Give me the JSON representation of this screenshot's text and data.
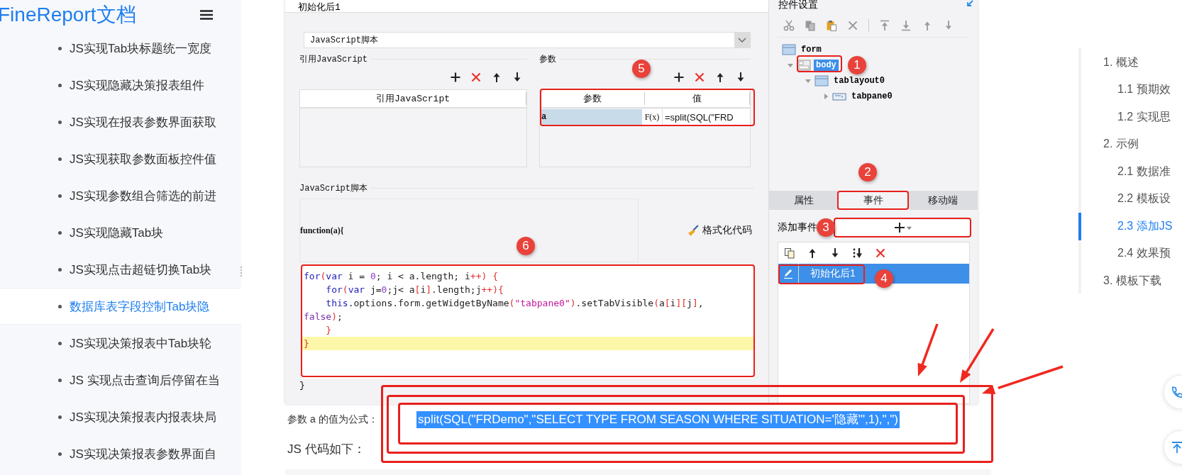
{
  "sidebar": {
    "logo": "FineReport文档",
    "items": [
      {
        "label": "JS实现Tab块标题统一宽度",
        "selected": false
      },
      {
        "label": "JS实现隐藏决策报表组件",
        "selected": false
      },
      {
        "label": "JS实现在报表参数界面获取",
        "selected": false
      },
      {
        "label": "JS实现获取参数面板控件值",
        "selected": false
      },
      {
        "label": "JS实现参数组合筛选的前进",
        "selected": false
      },
      {
        "label": "JS实现隐藏Tab块",
        "selected": false
      },
      {
        "label": "JS实现点击超链切换Tab块",
        "selected": false
      },
      {
        "label": "数据库表字段控制Tab块隐",
        "selected": true
      },
      {
        "label": "JS实现决策报表中Tab块轮",
        "selected": false
      },
      {
        "label": "JS 实现点击查询后停留在当",
        "selected": false
      },
      {
        "label": "JS实现决策报表内报表块局",
        "selected": false
      },
      {
        "label": "JS实现决策报表参数界面自",
        "selected": false
      }
    ]
  },
  "screenshot": {
    "dialog": {
      "title": "初始化后1",
      "type_select": {
        "value": "JavaScript脚本"
      },
      "refs": {
        "title": "引用JavaScript",
        "columns": [
          "引用JavaScript"
        ]
      },
      "params": {
        "title": "参数",
        "columns": [
          "参数",
          "值"
        ],
        "rows": [
          {
            "name": "a",
            "formula_button": "F(x)",
            "value": "=split(SQL(\"FRD",
            "selected": true
          }
        ]
      },
      "script": {
        "title": "JavaScript脚本",
        "header": "function(a){",
        "format_button": "格式化代码",
        "lines": [
          {
            "highlighted": false,
            "segments": [
              {
                "t": "for",
                "kind": "keyword"
              },
              {
                "t": "(",
                "kind": "bracket"
              },
              {
                "t": "var",
                "kind": "keyword"
              },
              {
                "t": " i = ",
                "kind": "plain"
              },
              {
                "t": "0",
                "kind": "number"
              },
              {
                "t": "; i < a.length; i",
                "kind": "plain"
              },
              {
                "t": "++",
                "kind": "bracket"
              },
              {
                "t": ") {",
                "kind": "bracket"
              }
            ]
          },
          {
            "highlighted": false,
            "segments": [
              {
                "t": "    for",
                "kind": "keyword"
              },
              {
                "t": "(",
                "kind": "bracket"
              },
              {
                "t": "var",
                "kind": "keyword"
              },
              {
                "t": " j=",
                "kind": "plain"
              },
              {
                "t": "0",
                "kind": "number"
              },
              {
                "t": ";j< a",
                "kind": "plain"
              },
              {
                "t": "[",
                "kind": "bracket"
              },
              {
                "t": "i",
                "kind": "plain"
              },
              {
                "t": "]",
                "kind": "bracket"
              },
              {
                "t": ".length;j",
                "kind": "plain"
              },
              {
                "t": "++",
                "kind": "bracket"
              },
              {
                "t": "){",
                "kind": "bracket"
              }
            ]
          },
          {
            "highlighted": false,
            "segments": [
              {
                "t": "    this",
                "kind": "keyword"
              },
              {
                "t": ".options.form.getWidgetByName",
                "kind": "plain"
              },
              {
                "t": "(",
                "kind": "bracket"
              },
              {
                "t": "\"tabpane0\"",
                "kind": "string"
              },
              {
                "t": ")",
                "kind": "bracket"
              },
              {
                "t": ".setTabVisible",
                "kind": "plain"
              },
              {
                "t": "(",
                "kind": "bracket"
              },
              {
                "t": "a",
                "kind": "plain"
              },
              {
                "t": "[",
                "kind": "bracket"
              },
              {
                "t": "i",
                "kind": "plain"
              },
              {
                "t": "][",
                "kind": "bracket"
              },
              {
                "t": "j",
                "kind": "plain"
              },
              {
                "t": "]",
                "kind": "bracket"
              },
              {
                "t": ",",
                "kind": "plain"
              }
            ]
          },
          {
            "highlighted": false,
            "segments": [
              {
                "t": "false",
                "kind": "literal"
              },
              {
                "t": ")",
                "kind": "bracket"
              },
              {
                "t": ";",
                "kind": "plain"
              }
            ]
          },
          {
            "highlighted": false,
            "segments": [
              {
                "t": "    }",
                "kind": "bracket"
              }
            ]
          },
          {
            "highlighted": true,
            "segments": [
              {
                "t": "}",
                "kind": "bracket"
              }
            ]
          }
        ],
        "footer": "}"
      }
    },
    "widget_panel": {
      "title": "控件设置",
      "tree": [
        {
          "label": "form",
          "kind": "form",
          "selected": false,
          "children": [
            {
              "label": "body",
              "kind": "body",
              "selected": true,
              "expanded": true,
              "children": [
                {
                  "label": "tablayout0",
                  "kind": "layout",
                  "selected": false,
                  "expanded": true,
                  "children": [
                    {
                      "label": "tabpane0",
                      "kind": "tab",
                      "selected": false,
                      "expanded": false
                    }
                  ]
                }
              ]
            }
          ]
        }
      ],
      "tabs": [
        {
          "label": "属性",
          "selected": false
        },
        {
          "label": "事件",
          "selected": true
        },
        {
          "label": "移动端",
          "selected": false
        }
      ],
      "add_event_label": "添加事件",
      "events": [
        {
          "label": "初始化后1",
          "selected": true
        }
      ]
    }
  },
  "annotations": [
    "1",
    "2",
    "3",
    "4",
    "5",
    "6"
  ],
  "caption": {
    "label": "参数 a 的值为公式：",
    "formula": "split(SQL(\"FRDemo\",\"SELECT TYPE FROM SEASON WHERE SITUATION='隐藏'\",1),\",\")"
  },
  "code_heading": "JS 代码如下：",
  "toc": [
    {
      "label": "1. 概述",
      "selected": false,
      "children": [
        {
          "label": "1.1 预期效",
          "selected": false
        },
        {
          "label": "1.2 实现思",
          "selected": false
        }
      ]
    },
    {
      "label": "2. 示例",
      "selected": false,
      "children": [
        {
          "label": "2.1 数据准",
          "selected": false
        },
        {
          "label": "2.2 模板设",
          "selected": false
        },
        {
          "label": "2.3 添加JS",
          "selected": true
        },
        {
          "label": "2.4 效果预",
          "selected": false
        }
      ]
    },
    {
      "label": "3. 模板下载",
      "selected": false
    }
  ]
}
